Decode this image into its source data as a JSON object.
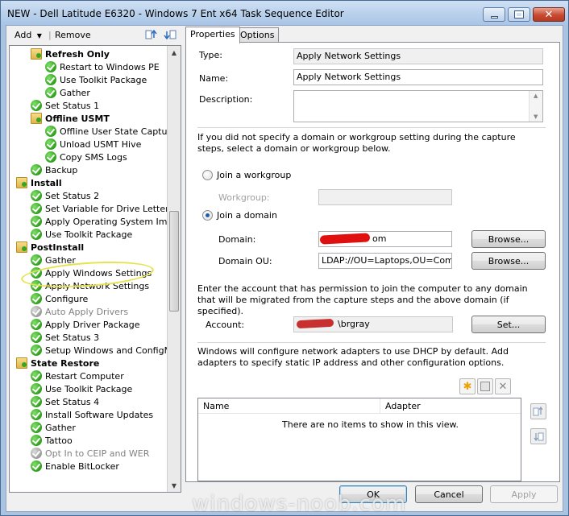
{
  "window": {
    "title": "NEW - Dell Latitude E6320 - Windows 7 Ent x64 Task Sequence Editor"
  },
  "toolbar": {
    "add_label": "Add",
    "remove_label": "Remove"
  },
  "tree": {
    "items": [
      {
        "label": "Refresh Only",
        "type": "group"
      },
      {
        "label": "Restart to Windows PE",
        "type": "step"
      },
      {
        "label": "Use Toolkit Package",
        "type": "step"
      },
      {
        "label": "Gather",
        "type": "step"
      },
      {
        "label": "Set Status 1",
        "type": "step"
      },
      {
        "label": "Offline USMT",
        "type": "group"
      },
      {
        "label": "Offline User State Capture",
        "type": "step"
      },
      {
        "label": "Unload USMT Hive",
        "type": "step"
      },
      {
        "label": "Copy SMS Logs",
        "type": "step"
      },
      {
        "label": "Backup",
        "type": "step"
      },
      {
        "label": "Install",
        "type": "group"
      },
      {
        "label": "Set Status 2",
        "type": "step"
      },
      {
        "label": "Set Variable for Drive Letter",
        "type": "step"
      },
      {
        "label": "Apply Operating System Image",
        "type": "step"
      },
      {
        "label": "Use Toolkit Package",
        "type": "step"
      },
      {
        "label": "PostInstall",
        "type": "group"
      },
      {
        "label": "Gather",
        "type": "step"
      },
      {
        "label": "Apply Windows Settings",
        "type": "step"
      },
      {
        "label": "Apply Network Settings",
        "type": "step"
      },
      {
        "label": "Configure",
        "type": "step"
      },
      {
        "label": "Auto Apply Drivers",
        "type": "disabled"
      },
      {
        "label": "Apply Driver Package",
        "type": "step"
      },
      {
        "label": "Set Status 3",
        "type": "step"
      },
      {
        "label": "Setup Windows and ConfigMgr",
        "type": "step"
      },
      {
        "label": "State Restore",
        "type": "group"
      },
      {
        "label": "Restart Computer",
        "type": "step"
      },
      {
        "label": "Use Toolkit Package",
        "type": "step"
      },
      {
        "label": "Set Status 4",
        "type": "step"
      },
      {
        "label": "Install Software Updates",
        "type": "step"
      },
      {
        "label": "Gather",
        "type": "step"
      },
      {
        "label": "Tattoo",
        "type": "step"
      },
      {
        "label": "Opt In to CEIP and WER",
        "type": "disabled"
      },
      {
        "label": "Enable BitLocker",
        "type": "step"
      }
    ]
  },
  "tabs": {
    "properties": "Properties",
    "options": "Options"
  },
  "form": {
    "type_label": "Type:",
    "type_value": "Apply Network Settings",
    "name_label": "Name:",
    "name_value": "Apply Network Settings",
    "description_label": "Description:",
    "description_value": "",
    "capture_note": "If you did not specify a domain or workgroup setting during the capture steps, select a domain or workgroup below.",
    "join_workgroup_label": "Join a workgroup",
    "workgroup_label": "Workgroup:",
    "workgroup_value": "",
    "join_domain_label": "Join a domain",
    "domain_label": "Domain:",
    "domain_value": "om",
    "domain_ou_label": "Domain OU:",
    "domain_ou_value": "LDAP://OU=Laptops,OU=Comput",
    "browse_label": "Browse...",
    "account_note": "Enter the account that has permission to join the computer to any domain that will be migrated from the capture steps and the above domain (if specified).",
    "account_label": "Account:",
    "account_value": "\\brgray",
    "set_label": "Set...",
    "dhcp_note": "Windows will configure network adapters to use DHCP by default. Add adapters to specify static IP address and other configuration options."
  },
  "adapters": {
    "columns": [
      "Name",
      "Adapter"
    ],
    "empty_text": "There are no items to show in this view."
  },
  "footer": {
    "ok_label": "OK",
    "cancel_label": "Cancel",
    "apply_label": "Apply"
  },
  "watermark": "windows-noob.com"
}
